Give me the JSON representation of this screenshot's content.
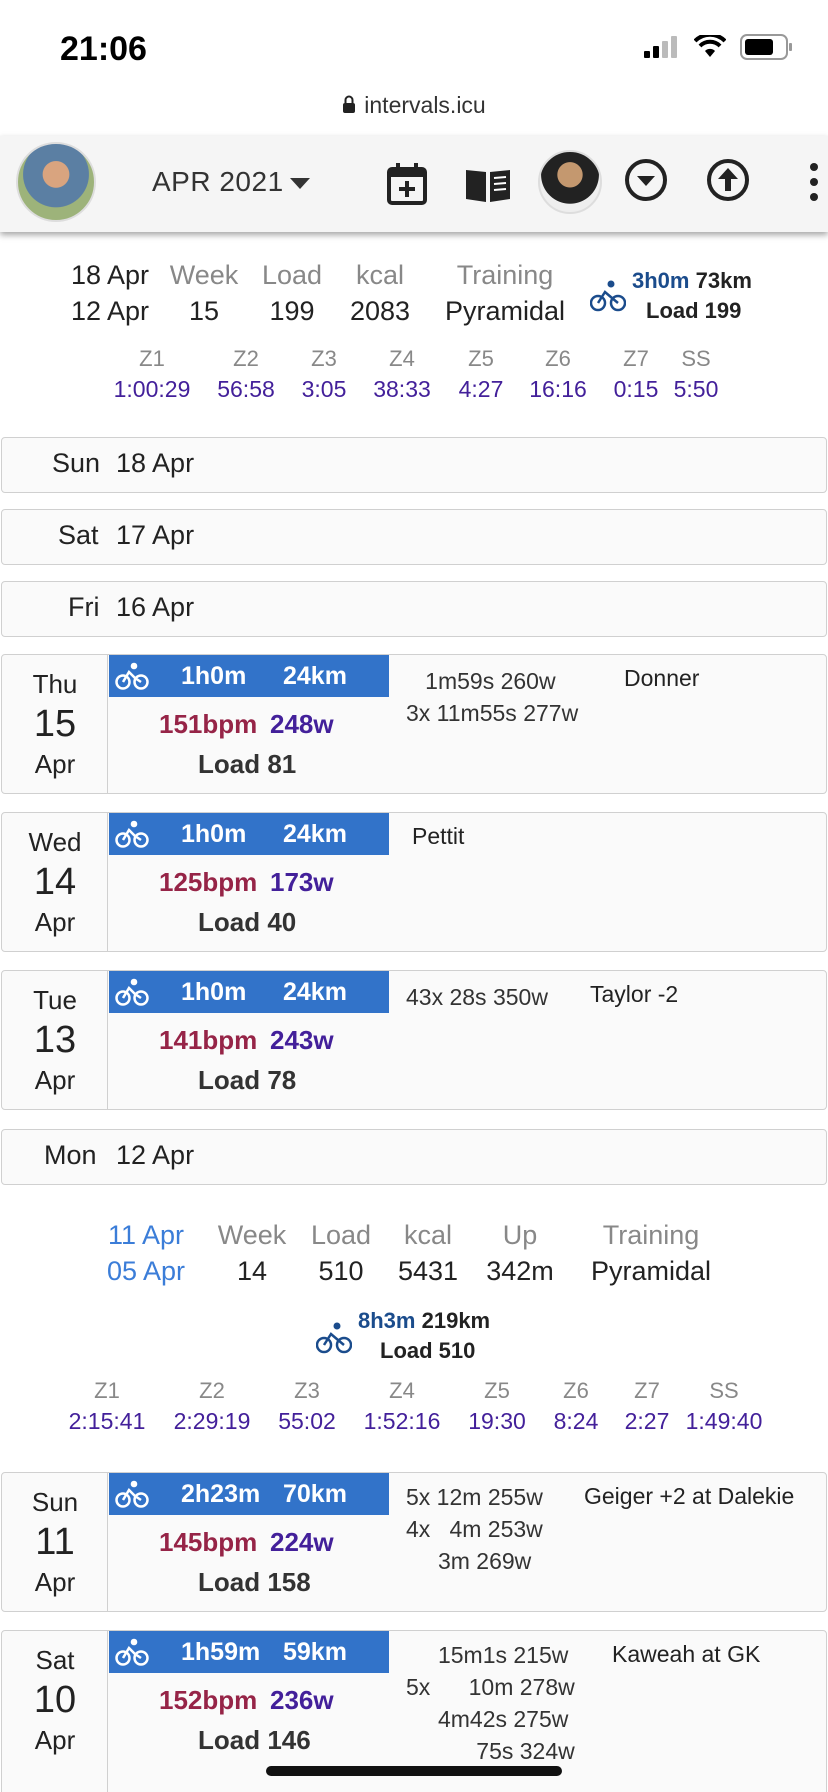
{
  "status": {
    "time": "21:06",
    "url": "intervals.icu"
  },
  "header": {
    "month": "APR 2021"
  },
  "week1": {
    "range_end": "18 Apr",
    "range_start": "12 Apr",
    "week_label": "Week",
    "week": "15",
    "load_label": "Load",
    "load": "199",
    "kcal_label": "kcal",
    "kcal": "2083",
    "training_label": "Training",
    "training": "Pyramidal",
    "ride_time": "3h0m",
    "ride_dist": "73km",
    "ride_load": "Load 199",
    "zones": [
      {
        "z": "Z1",
        "v": "1:00:29"
      },
      {
        "z": "Z2",
        "v": "56:58"
      },
      {
        "z": "Z3",
        "v": "3:05"
      },
      {
        "z": "Z4",
        "v": "38:33"
      },
      {
        "z": "Z5",
        "v": "4:27"
      },
      {
        "z": "Z6",
        "v": "16:16"
      },
      {
        "z": "Z7",
        "v": "0:15"
      },
      {
        "z": "SS",
        "v": "5:50"
      }
    ]
  },
  "empty_days": [
    {
      "dow": "Sun",
      "date": "18 Apr"
    },
    {
      "dow": "Sat",
      "date": "17 Apr"
    },
    {
      "dow": "Fri",
      "date": "16 Apr"
    },
    {
      "dow": "Mon",
      "date": "12 Apr"
    }
  ],
  "activities": [
    {
      "dow": "Thu",
      "day": "15",
      "mon": "Apr",
      "dur": "1h0m",
      "dist": "24km",
      "hr": "151bpm",
      "pw": "248w",
      "load": "Load 81",
      "intervals": "   1m59s 260w\n3x 11m55s 277w",
      "name": "Donner"
    },
    {
      "dow": "Wed",
      "day": "14",
      "mon": "Apr",
      "dur": "1h0m",
      "dist": "24km",
      "hr": "125bpm",
      "pw": "173w",
      "load": "Load 40",
      "intervals": "",
      "name": "Pettit"
    },
    {
      "dow": "Tue",
      "day": "13",
      "mon": "Apr",
      "dur": "1h0m",
      "dist": "24km",
      "hr": "141bpm",
      "pw": "243w",
      "load": "Load 78",
      "intervals": "43x 28s 350w",
      "name": "Taylor -2"
    },
    {
      "dow": "Sun",
      "day": "11",
      "mon": "Apr",
      "dur": "2h23m",
      "dist": "70km",
      "hr": "145bpm",
      "pw": "224w",
      "load": "Load 158",
      "intervals": "5x 12m 255w\n4x   4m 253w\n     3m 269w",
      "name": "Geiger +2 at Dalekie"
    },
    {
      "dow": "Sat",
      "day": "10",
      "mon": "Apr",
      "dur": "1h59m",
      "dist": "59km",
      "hr": "152bpm",
      "pw": "236w",
      "load": "Load 146",
      "intervals": "     15m1s 215w\n5x      10m 278w\n     4m42s 275w\n           75s 324w",
      "name": "Kaweah at GK"
    }
  ],
  "week2": {
    "range_end": "11 Apr",
    "range_start": "05 Apr",
    "week_label": "Week",
    "week": "14",
    "load_label": "Load",
    "load": "510",
    "kcal_label": "kcal",
    "kcal": "5431",
    "up_label": "Up",
    "up": "342m",
    "training_label": "Training",
    "training": "Pyramidal",
    "ride_time": "8h3m",
    "ride_dist": "219km",
    "ride_load": "Load 510",
    "zones": [
      {
        "z": "Z1",
        "v": "2:15:41"
      },
      {
        "z": "Z2",
        "v": "2:29:19"
      },
      {
        "z": "Z3",
        "v": "55:02"
      },
      {
        "z": "Z4",
        "v": "1:52:16"
      },
      {
        "z": "Z5",
        "v": "19:30"
      },
      {
        "z": "Z6",
        "v": "8:24"
      },
      {
        "z": "Z7",
        "v": "2:27"
      },
      {
        "z": "SS",
        "v": "1:49:40"
      }
    ]
  }
}
